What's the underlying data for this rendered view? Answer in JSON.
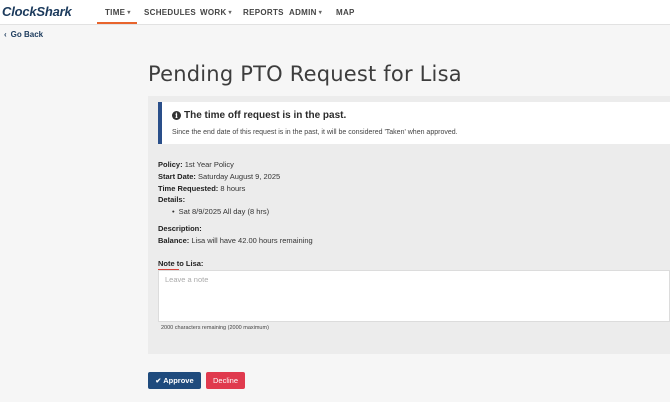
{
  "app": {
    "logo": "ClockShark"
  },
  "nav": {
    "items": [
      {
        "label": "TIME",
        "has_dropdown": true,
        "active": true
      },
      {
        "label": "SCHEDULES",
        "has_dropdown": false
      },
      {
        "label": "WORK",
        "has_dropdown": true
      },
      {
        "label": "REPORTS",
        "has_dropdown": false
      },
      {
        "label": "ADMIN",
        "has_dropdown": true
      },
      {
        "label": "MAP",
        "has_dropdown": false
      }
    ],
    "accent_color": "#e8642c"
  },
  "go_back": {
    "label": "Go Back",
    "icon": "chevron-left-icon"
  },
  "page": {
    "title": "Pending PTO Request for Lisa"
  },
  "alert": {
    "icon": "info-circle-icon",
    "title": "The time off request is in the past.",
    "body": "Since the end date of this request is in the past, it will be considered 'Taken' when approved.",
    "border_color": "#2a4f8a"
  },
  "request": {
    "policy_label": "Policy:",
    "policy_value": "1st Year Policy",
    "start_label": "Start Date:",
    "start_value": "Saturday August 9, 2025",
    "time_label": "Time Requested:",
    "time_value": "8 hours",
    "details_label": "Details:",
    "details": [
      "Sat 8/9/2025 All day (8 hrs)"
    ],
    "description_label": "Description:",
    "description_value": "",
    "balance_label": "Balance:",
    "balance_value": "Lisa will have 42.00 hours remaining"
  },
  "note": {
    "label": "Note to Lisa:",
    "placeholder": "Leave a note",
    "value": "",
    "char_count": "2000 characters remaining (2000 maximum)"
  },
  "actions": {
    "approve_label": "Approve",
    "approve_icon": "check-icon",
    "approve_color": "#1f4b7d",
    "decline_label": "Decline",
    "decline_color": "#e03a4e"
  }
}
